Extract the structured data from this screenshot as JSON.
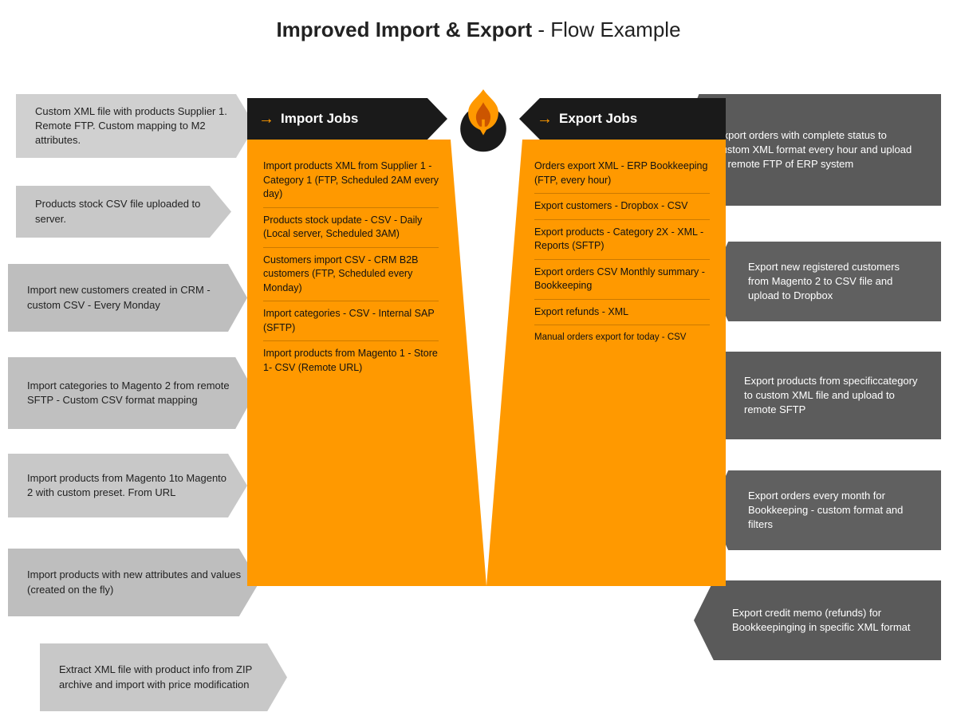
{
  "title": {
    "bold": "Improved Import & Export",
    "normal": " - Flow Example"
  },
  "left_items": [
    {
      "id": "left-1",
      "text": "Custom XML file with products Supplier 1. Remote FTP. Custom mapping to M2 attributes."
    },
    {
      "id": "left-2",
      "text": "Products stock CSV file uploaded to server."
    },
    {
      "id": "left-3",
      "text": "Import new customers created in CRM - custom CSV - Every Monday"
    },
    {
      "id": "left-4",
      "text": "Import categories to Magento 2 from remote SFTP - Custom CSV format mapping"
    },
    {
      "id": "left-5",
      "text": "Import products from Magento 1to Magento 2 with custom preset. From URL"
    },
    {
      "id": "left-6",
      "text": "Import products with new attributes and values (created on the fly)"
    },
    {
      "id": "left-7",
      "text": "Extract XML file with product info from ZIP archive and import with price modification"
    }
  ],
  "right_items": [
    {
      "id": "right-1",
      "text": "Export orders with complete status to custom XML format every hour and upload to remote FTP of ERP system"
    },
    {
      "id": "right-2",
      "text": "Export new registered customers from Magento 2 to CSV file and upload to Dropbox"
    },
    {
      "id": "right-3",
      "text": "Export products from specificcategory to custom XML file and upload to remote SFTP"
    },
    {
      "id": "right-4",
      "text": "Export orders every month for Bookkeeping - custom format and filters"
    },
    {
      "id": "right-5",
      "text": "Export credit memo (refunds) for Bookkeepinging in specific XML format"
    }
  ],
  "center": {
    "import_label": "Import Jobs",
    "export_label": "Export Jobs",
    "import_jobs": [
      "Import products XML from Supplier 1 - Category 1 (FTP, Scheduled 2AM every day)",
      "Products stock update - CSV - Daily (Local server, Scheduled 3AM)",
      "Customers import CSV - CRM B2B customers (FTP, Scheduled every Monday)",
      "Import categories - CSV - Internal SAP (SFTP)",
      "Import products from Magento 1 - Store 1- CSV (Remote URL)"
    ],
    "export_jobs": [
      "Orders export XML - ERP Bookkeeping (FTP, every hour)",
      "Export customers - Dropbox - CSV",
      "Export products - Category 2X - XML - Reports (SFTP)",
      "Export orders CSV Monthly summary - Bookkeeping",
      "Export refunds - XML",
      "Manual orders export for today - CSV"
    ]
  },
  "colors": {
    "orange": "#f90000",
    "dark": "#1a1a1a",
    "gray_left": "#c8c8c8",
    "gray_right": "#5a5a5a",
    "amber": "#f99900"
  }
}
